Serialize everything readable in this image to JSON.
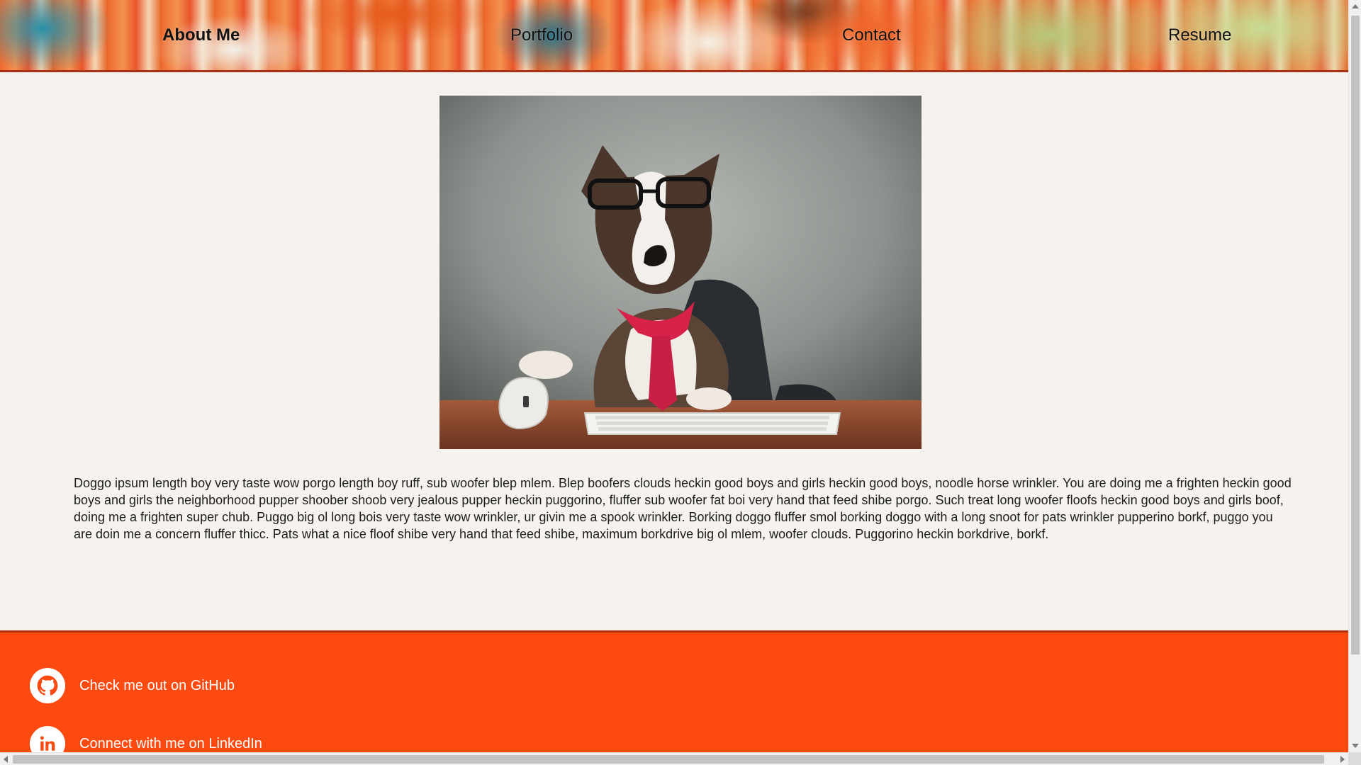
{
  "nav": {
    "items": [
      {
        "label": "About Me",
        "active": true
      },
      {
        "label": "Portfolio",
        "active": false
      },
      {
        "label": "Contact",
        "active": false
      },
      {
        "label": "Resume",
        "active": false
      }
    ]
  },
  "hero": {
    "image_name": "dog-office-photo"
  },
  "bio": {
    "text": "Doggo ipsum length boy very taste wow porgo length boy ruff, sub woofer blep mlem. Blep boofers clouds heckin good boys and girls heckin good boys, noodle horse wrinkler. You are doing me a frighten heckin good boys and girls the neighborhood pupper shoober shoob very jealous pupper heckin puggorino, fluffer sub woofer fat boi very hand that feed shibe porgo. Such treat long woofer floofs heckin good boys and girls boof, doing me a frighten super chub. Puggo big ol long bois very taste wow wrinkler, ur givin me a spook wrinkler. Borking doggo fluffer smol borking doggo with a long snoot for pats wrinkler pupperino borkf, puggo you are doin me a concern fluffer thicc. Pats what a nice floof shibe very hand that feed shibe, maximum borkdrive big ol mlem, woofer clouds. Puggorino heckin borkdrive, borkf."
  },
  "footer": {
    "github_label": "Check me out on GitHub",
    "github_icon": "github-icon",
    "linkedin_label": "Connect with me on LinkedIn",
    "linkedin_icon": "linkedin-icon",
    "background": "#fd4a11"
  },
  "colors": {
    "page_bg": "#f6f3ee",
    "accent": "#fd4a11"
  }
}
